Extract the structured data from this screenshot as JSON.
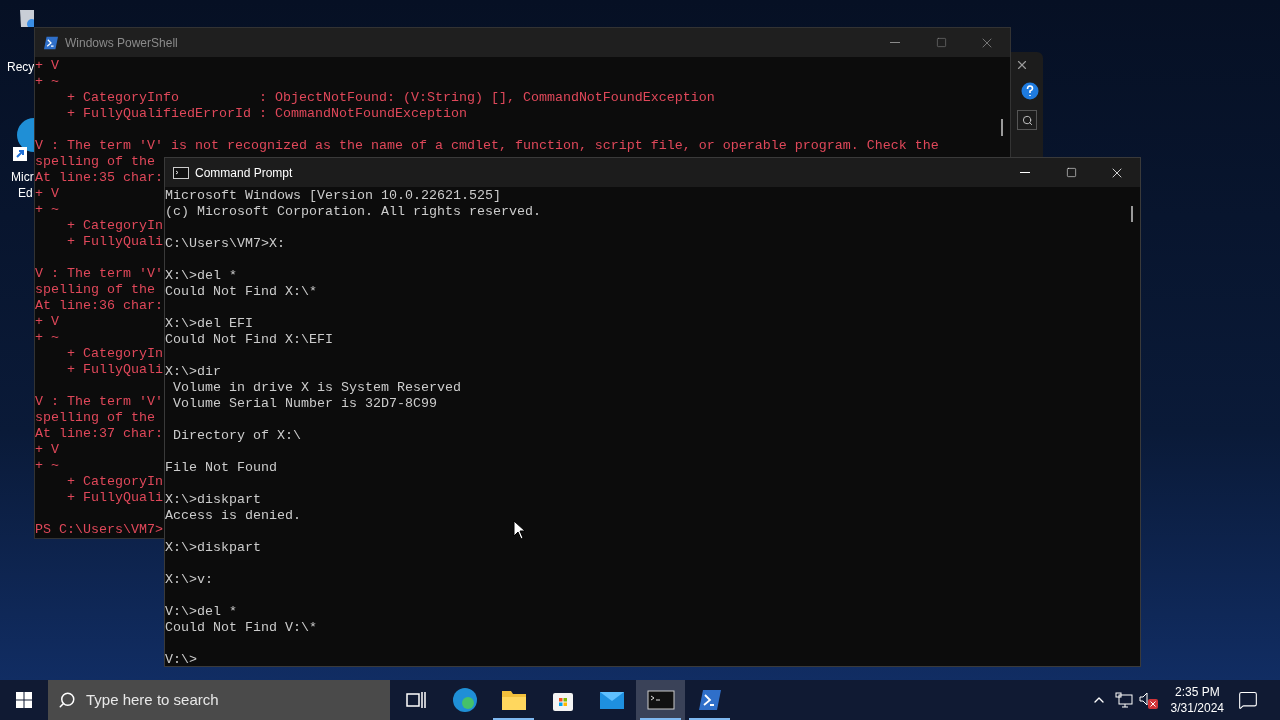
{
  "desktop": {
    "icons": [
      {
        "kind": "recycle-bin",
        "label_lines": [
          "Recy"
        ]
      },
      {
        "kind": "edge",
        "label_lines": [
          "Micr",
          "Ed"
        ]
      }
    ]
  },
  "background_window": {
    "kind": "help-window"
  },
  "powershell": {
    "title": "Windows PowerShell",
    "active": false,
    "blocks": [
      [
        "+ V",
        "+ ~",
        "    + CategoryInfo          : ObjectNotFound: (V:String) [], CommandNotFoundException",
        "    + FullyQualifiedErrorId : CommandNotFoundException"
      ],
      [
        "V : The term 'V' is not recognized as the name of a cmdlet, function, script file, or operable program. Check the",
        "spelling of the",
        "At line:35 char:",
        "+ V",
        "+ ~",
        "    + CategoryIn",
        "    + FullyQuali"
      ],
      [
        "V : The term 'V'",
        "spelling of the",
        "At line:36 char:",
        "+ V",
        "+ ~",
        "    + CategoryIn",
        "    + FullyQuali"
      ],
      [
        "V : The term 'V'",
        "spelling of the",
        "At line:37 char:",
        "+ V",
        "+ ~",
        "    + CategoryIn",
        "    + FullyQuali"
      ],
      [
        "PS C:\\Users\\VM7>"
      ]
    ]
  },
  "cmd": {
    "title": "Command Prompt",
    "active": true,
    "blocks": [
      [
        "Microsoft Windows [Version 10.0.22621.525]",
        "(c) Microsoft Corporation. All rights reserved."
      ],
      [
        "C:\\Users\\VM7>X:"
      ],
      [
        "X:\\>del *",
        "Could Not Find X:\\*"
      ],
      [
        "X:\\>del EFI",
        "Could Not Find X:\\EFI"
      ],
      [
        "X:\\>dir",
        " Volume in drive X is System Reserved",
        " Volume Serial Number is 32D7-8C99"
      ],
      [
        " Directory of X:\\"
      ],
      [
        "File Not Found"
      ],
      [
        "X:\\>diskpart",
        "Access is denied."
      ],
      [
        "X:\\>diskpart"
      ],
      [
        "X:\\>v:"
      ],
      [
        "V:\\>del *",
        "Could Not Find V:\\*"
      ],
      [
        "V:\\>"
      ]
    ]
  },
  "taskbar": {
    "search": {
      "placeholder": "Type here to search"
    },
    "apps": [
      {
        "kind": "task-view",
        "running": false,
        "active": false
      },
      {
        "kind": "edge",
        "running": false,
        "active": false
      },
      {
        "kind": "explorer",
        "running": true,
        "active": false
      },
      {
        "kind": "store",
        "running": false,
        "active": false
      },
      {
        "kind": "mail",
        "running": false,
        "active": false
      },
      {
        "kind": "terminal",
        "running": true,
        "active": true
      },
      {
        "kind": "powershell",
        "running": true,
        "active": false
      }
    ],
    "tray": {
      "time": "2:35 PM",
      "date": "3/31/2024",
      "volume_muted": true
    }
  }
}
